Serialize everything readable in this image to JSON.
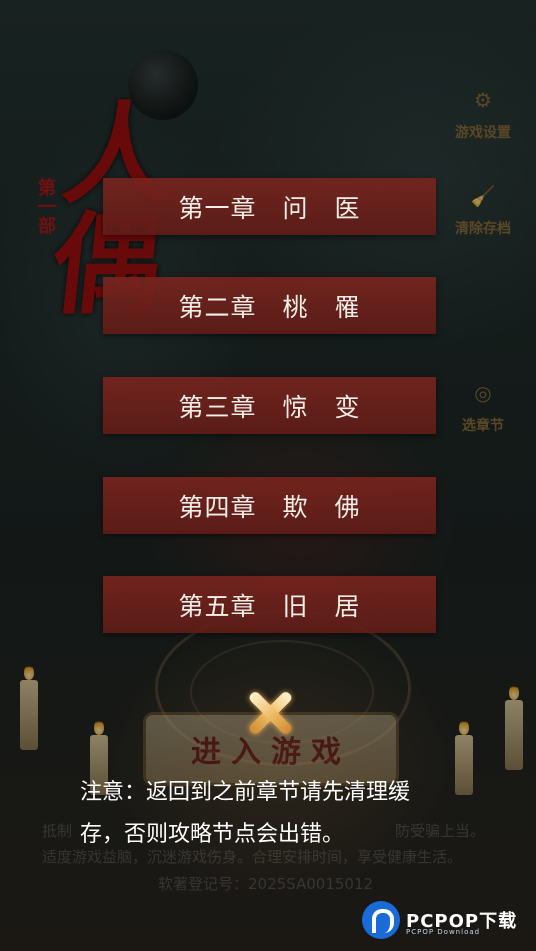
{
  "logo": {
    "title": "人偶",
    "subtitle": "第一部"
  },
  "side_menu": [
    {
      "label": "游戏设置",
      "icon": "gear-icon"
    },
    {
      "label": "清除存档",
      "icon": "broom-icon"
    },
    {
      "label": "选章节",
      "icon": "chapter-select-icon"
    }
  ],
  "chapters": [
    {
      "label": "第一章　问　医"
    },
    {
      "label": "第二章　桃　罹"
    },
    {
      "label": "第三章　惊　变"
    },
    {
      "label": "第四章　欺　佛"
    },
    {
      "label": "第五章　旧　居"
    }
  ],
  "enter_game": "进入游戏",
  "notice": "注意：返回到之前章节请先清理缓存，否则攻略节点会出错。",
  "background_text": {
    "line1": "抵制",
    "line1_right": "防受骗上当。",
    "line2": "适度游戏益脑，沉迷游戏伤身。合理安排时间，享受健康生活。",
    "registration": "软著登记号：2025SA0015012"
  },
  "watermark": {
    "brand": "PCPOP下载",
    "sub": "PCPOP Download"
  }
}
